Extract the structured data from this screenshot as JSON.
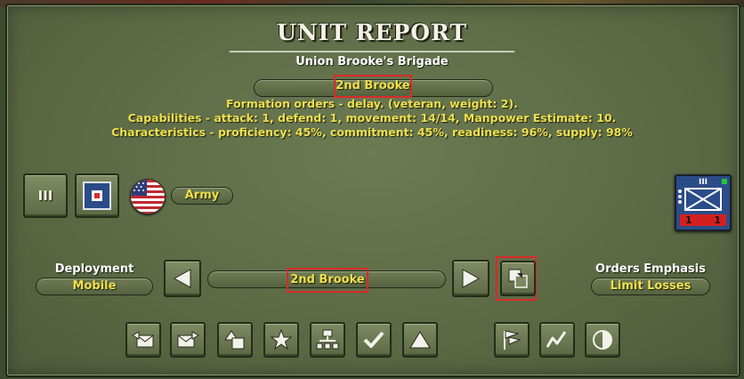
{
  "header": {
    "title": "UNIT REPORT",
    "subtitle": "Union Brooke's Brigade",
    "unit_name": "2nd Brooke"
  },
  "info": {
    "formation_orders": "Formation orders - delay. (veteran, weight: 2).",
    "capabilities": "Capabilities - attack: 1, defend: 1, movement: 14/14, Manpower Estimate: 10.",
    "characteristics": "Characteristics - proficiency: 45%, commitment: 45%, readiness: 96%, supply: 98%"
  },
  "unit": {
    "size_symbol": "III",
    "branch_label": "Army",
    "flag_icon": "us-flag-icon",
    "counter": {
      "symbol": "III",
      "values": [
        "1",
        "1"
      ]
    }
  },
  "deployment": {
    "label": "Deployment",
    "value": "Mobile"
  },
  "selector": {
    "value": "2nd Brooke"
  },
  "orders": {
    "label": "Orders Emphasis",
    "value": "Limit Losses"
  },
  "toolbar_icons": [
    "mail-left-icon",
    "mail-right-icon",
    "shapes-icon",
    "star-icon",
    "hierarchy-icon",
    "checkmark-icon",
    "triangle-icon",
    "flags-icon",
    "zigzag-icon",
    "half-circle-icon"
  ],
  "colors": {
    "accent_yellow": "#f0e04a",
    "highlight_red": "#d92b2b",
    "panel_green": "#5c6a45",
    "union_blue": "#2b4c88"
  }
}
